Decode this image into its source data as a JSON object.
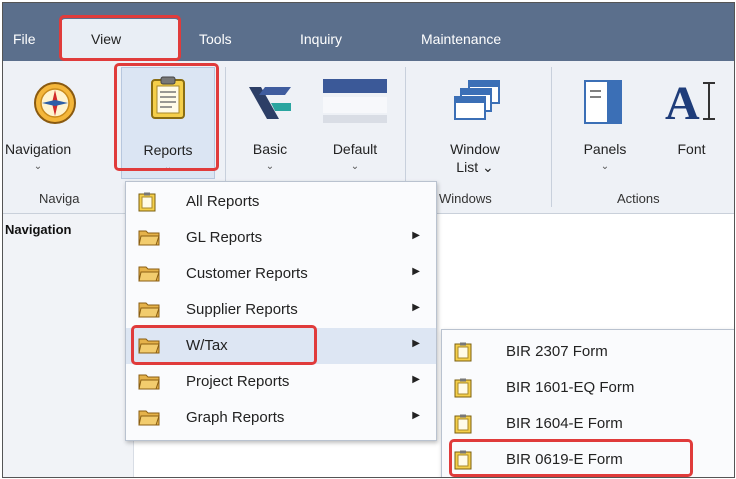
{
  "menubar": {
    "items": [
      "File",
      "View",
      "Tools",
      "Inquiry",
      "Maintenance"
    ]
  },
  "ribbon": {
    "buttons": {
      "navigation": {
        "label": "Navigation",
        "chev": "⌄"
      },
      "reports": {
        "label": "Reports",
        "chev": "⌄"
      },
      "basic": {
        "label": "Basic",
        "chev": "⌄"
      },
      "default": {
        "label": "Default",
        "chev": "⌄"
      },
      "window_list_1": "Window",
      "window_list_2": "List ⌄",
      "panels": {
        "label": "Panels",
        "chev": "⌄"
      },
      "font": {
        "label": "Font"
      }
    },
    "groups": {
      "navigation": "Naviga",
      "windows": "Windows",
      "actions": "Actions"
    }
  },
  "panel": {
    "navigation_title": "Navigation"
  },
  "reports_menu": {
    "items": [
      {
        "label": "All Reports",
        "icon": "report-icon",
        "arrow": ""
      },
      {
        "label": "GL Reports",
        "icon": "folder-icon",
        "arrow": "▶"
      },
      {
        "label": "Customer Reports",
        "icon": "folder-icon",
        "arrow": "▶"
      },
      {
        "label": "Supplier Reports",
        "icon": "folder-icon",
        "arrow": "▶"
      },
      {
        "label": "W/Tax",
        "icon": "folder-icon",
        "arrow": "▶"
      },
      {
        "label": "Project Reports",
        "icon": "folder-icon",
        "arrow": "▶"
      },
      {
        "label": "Graph Reports",
        "icon": "folder-icon",
        "arrow": "▶"
      }
    ]
  },
  "wtax_submenu": {
    "items": [
      {
        "label": "BIR 2307 Form",
        "icon": "report-icon"
      },
      {
        "label": "BIR 1601-EQ Form",
        "icon": "report-icon"
      },
      {
        "label": "BIR 1604-E Form",
        "icon": "report-icon"
      },
      {
        "label": "BIR 0619-E Form",
        "icon": "report-icon"
      }
    ]
  },
  "colors": {
    "menubar": "#5b6f8c",
    "highlight": "#e03b3b",
    "ribbon": "#eef1f6"
  }
}
